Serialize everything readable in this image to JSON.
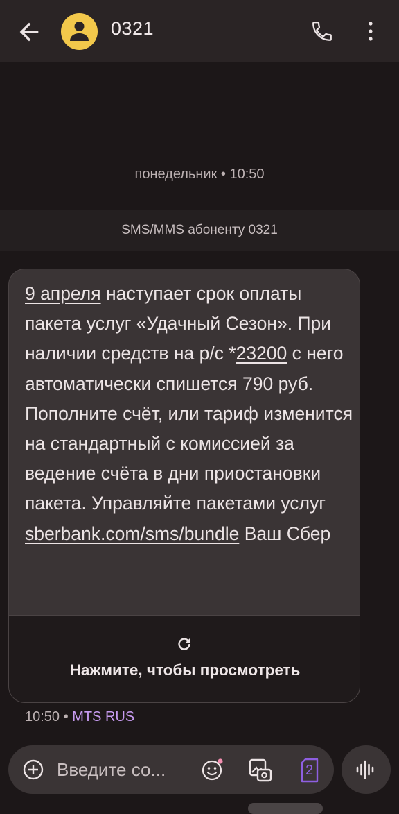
{
  "header": {
    "contact_name": "0321"
  },
  "thread": {
    "date_separator": "понедельник • 10:50",
    "sms_banner": "SMS/MMS абоненту 0321"
  },
  "message": {
    "part1_link": "9 апреля",
    "part2": " наступает срок оплаты пакета услуг «Удачный Сезон». При наличии средств на р/с *",
    "part3_link": "23200",
    "part4": " с него автоматически спишется 790 руб. Пополните счёт, или тариф изменится на стандартный с комиссией за ведение счёта в дни приостановки пакета. Управляйте пакетами услуг ",
    "part5_link": "sberbank.com/sms/bundle",
    "part6": " Ваш Сбер",
    "preview_label": "Нажмите, чтобы просмотреть",
    "time": "10:50",
    "separator": " • ",
    "carrier": "MTS RUS"
  },
  "composer": {
    "placeholder": "Введите со...",
    "sim_number": "2"
  },
  "colors": {
    "avatar": "#f2c84b",
    "carrier": "#c79bf0",
    "sim_icon": "#8e5fe0"
  },
  "icons": {
    "back": "arrow-left-icon",
    "avatar": "person-icon",
    "call": "phone-icon",
    "more": "more-vert-icon",
    "refresh": "refresh-icon",
    "add": "plus-circle-icon",
    "emoji": "emoji-icon",
    "gallery": "gallery-icon",
    "sim": "sim-card-icon",
    "voice": "voice-waveform-icon"
  }
}
